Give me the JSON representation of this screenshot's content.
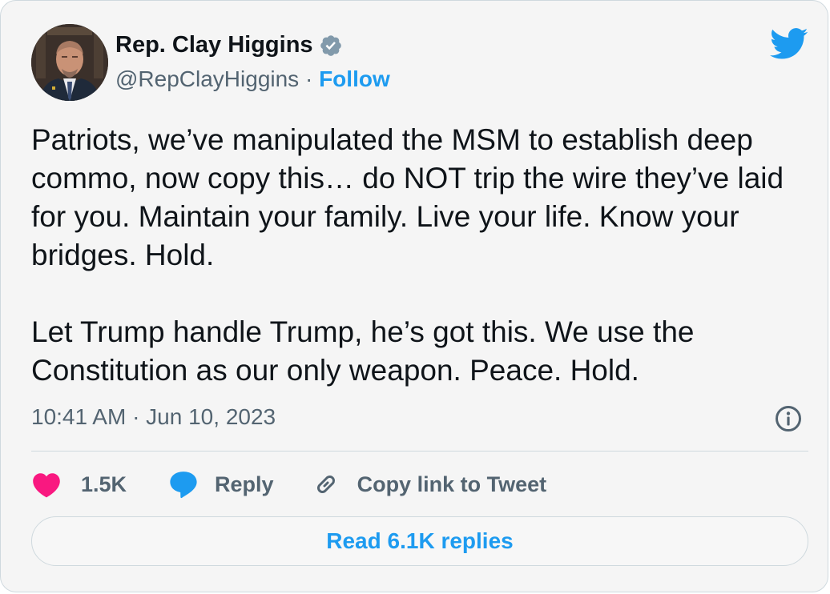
{
  "tweet": {
    "author": {
      "name": "Rep. Clay Higgins",
      "handle": "@RepClayHiggins",
      "separator": "·",
      "follow_label": "Follow"
    },
    "body": [
      "Patriots, we’ve manipulated the MSM to establish deep commo, now copy this… do NOT trip the wire they’ve laid for you. Maintain your family. Live your life. Know your bridges. Hold.",
      "Let Trump handle Trump, he’s got this. We use the Constitution as our only weapon. Peace. Hold."
    ],
    "timestamp": "10:41 AM · Jun 10, 2023",
    "actions": {
      "like_count": "1.5K",
      "reply_label": "Reply",
      "copy_link_label": "Copy link to Tweet"
    },
    "read_replies_label": "Read 6.1K replies"
  },
  "icons": {
    "brand": "twitter-bird-icon",
    "verified": "verified-badge-icon",
    "info": "info-icon",
    "like": "heart-icon",
    "reply": "speech-bubble-icon",
    "link": "link-icon"
  },
  "colors": {
    "accent": "#1d9bf0",
    "like": "#f91880",
    "verified_badge": "#829aab",
    "text_primary": "#0f1419",
    "text_secondary": "#536471"
  }
}
